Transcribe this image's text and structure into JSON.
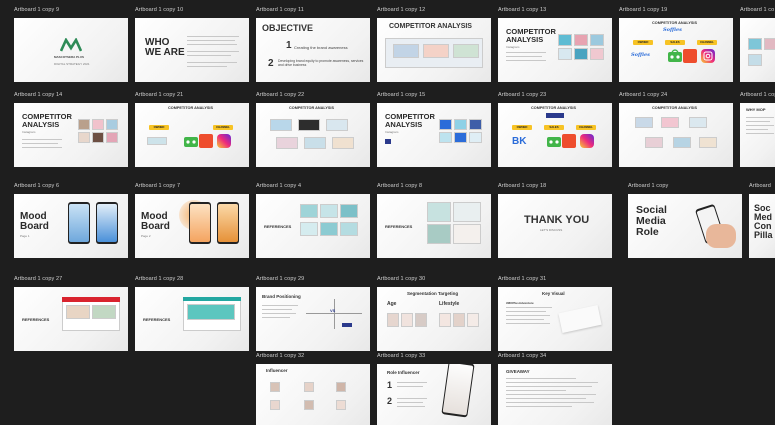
{
  "artboards": {
    "a9": {
      "label": "Artboard 1 copy 9",
      "brand": "MASCOTSERA PLUS",
      "sub": "DIGITAL STRATEGY 2021"
    },
    "a10": {
      "label": "Artboard 1 copy 10",
      "heading1": "WHO",
      "heading2": "WE ARE"
    },
    "a11": {
      "label": "Artboard 1 copy 11",
      "title": "OBJECTIVE",
      "n1": "1",
      "o1": "Creating the brand awareness",
      "n2": "2",
      "o2": "Developing brand equity to promote awareness, services and drive business"
    },
    "a12": {
      "label": "Artboard 1 copy 12",
      "title": "COMPETITOR ANALYSIS"
    },
    "a13": {
      "label": "Artboard 1 copy 13",
      "title1": "COMPETITOR",
      "title2": "ANALYSIS",
      "sub": "Instagram"
    },
    "a19": {
      "label": "Artboard 1 copy 19",
      "title": "COMPETITOR ANALYSIS",
      "brand": "Soffies",
      "chip1": "OWNED",
      "chip2": "SALES",
      "chip3": "CHANNEL",
      "brand_logo": "Soffies"
    },
    "a_edge1": {
      "label": "Artboard 1 co"
    },
    "a14": {
      "label": "Artboard 1 copy 14",
      "title1": "COMPETITOR",
      "title2": "ANALYSIS",
      "sub": "Instagram"
    },
    "a21": {
      "label": "Artboard 1 copy 21",
      "title": "COMPETITOR ANALYSIS",
      "chip1": "OWNED",
      "chip2": "CHANNEL"
    },
    "a22": {
      "label": "Artboard 1 copy 22",
      "title": "COMPETITOR ANALYSIS"
    },
    "a15": {
      "label": "Artboard 1 copy 15",
      "title1": "COMPETITOR",
      "title2": "ANALYSIS",
      "sub": "Instagram"
    },
    "a23": {
      "label": "Artboard 1 copy 23",
      "title": "COMPETITOR ANALYSIS",
      "chip1": "OWNED",
      "chip2": "SALES",
      "chip3": "CHANNEL",
      "logo": "BK"
    },
    "a24": {
      "label": "Artboard 1 copy 24",
      "title": "COMPETITOR ANALYSIS"
    },
    "a_edge2": {
      "label": "Artboard 1 copy",
      "title": "WHY MOP"
    },
    "a6": {
      "label": "Artboard 1 copy 6",
      "title1": "Mood",
      "title2": "Board",
      "sub": "Page 1"
    },
    "a7": {
      "label": "Artboard 1 copy 7",
      "title1": "Mood",
      "title2": "Board",
      "sub": "Page 2"
    },
    "a4": {
      "label": "Artboard 1 copy 4",
      "title": "REFERENCES"
    },
    "a8": {
      "label": "Artboard 1 copy 8",
      "title": "REFERENCES"
    },
    "a18": {
      "label": "Artboard 1 copy 18",
      "title": "THANK YOU",
      "sub": "LET'S DISCUSS"
    },
    "a_copy": {
      "label": "Artboard 1 copy",
      "l1": "Social",
      "l2": "Media",
      "l3": "Role"
    },
    "a_edge3": {
      "label": "Artboard",
      "l1": "Soc",
      "l2": "Med",
      "l3": "Con",
      "l4": "Pilla"
    },
    "a27": {
      "label": "Artboard 1 copy 27",
      "title": "REFERENCES"
    },
    "a28": {
      "label": "Artboard 1 copy 28",
      "title": "REFERENCES"
    },
    "a29": {
      "label": "Artboard 1 copy 29",
      "title": "Brand Positioning",
      "vs": "VS"
    },
    "a30": {
      "label": "Artboard 1 copy 30",
      "title": "Segmentation Targeting",
      "age": "Age",
      "lifestyle": "Lifestyle"
    },
    "a31": {
      "label": "Artboard 1 copy 31",
      "title": "Key Visual",
      "tag": "#MOPlusAdventure"
    },
    "a32": {
      "label": "Artboard 1 copy 32",
      "title": "Influencer"
    },
    "a33": {
      "label": "Artboard 1 copy 33",
      "title": "Role Influencer",
      "n1": "1",
      "n2": "2"
    },
    "a34": {
      "label": "Artboard 1 copy 34",
      "title": "GIVEAWAY"
    }
  },
  "colors": {
    "canvas": "#1e1e1e",
    "brand_green": "#2e8b57",
    "chip_yellow": "#f7c325",
    "ig_pink": "#e1306c",
    "blue": "#2b6cd9"
  }
}
